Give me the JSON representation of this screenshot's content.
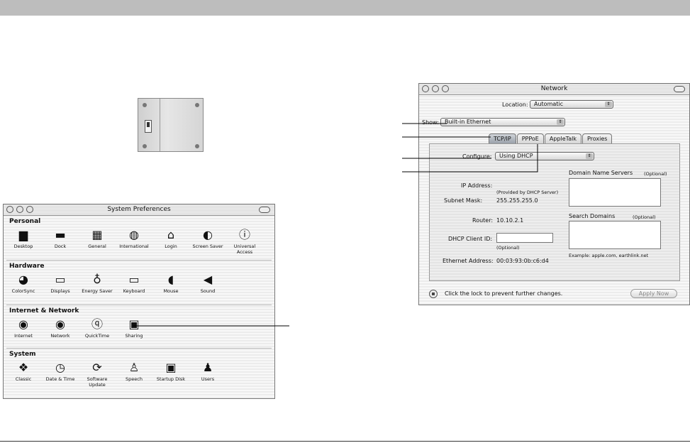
{
  "system_preferences": {
    "title": "System Preferences",
    "sections": [
      {
        "title": "Personal",
        "items": [
          {
            "label": "Desktop",
            "icon": "desktop-icon"
          },
          {
            "label": "Dock",
            "icon": "dock-icon"
          },
          {
            "label": "General",
            "icon": "general-icon"
          },
          {
            "label": "International",
            "icon": "international-icon"
          },
          {
            "label": "Login",
            "icon": "login-icon"
          },
          {
            "label": "Screen Saver",
            "icon": "screen-saver-icon"
          },
          {
            "label": "Universal Access",
            "icon": "universal-access-icon"
          }
        ]
      },
      {
        "title": "Hardware",
        "items": [
          {
            "label": "ColorSync",
            "icon": "colorsync-icon"
          },
          {
            "label": "Displays",
            "icon": "displays-icon"
          },
          {
            "label": "Energy Saver",
            "icon": "energy-saver-icon"
          },
          {
            "label": "Keyboard",
            "icon": "keyboard-icon"
          },
          {
            "label": "Mouse",
            "icon": "mouse-icon"
          },
          {
            "label": "Sound",
            "icon": "sound-icon"
          }
        ]
      },
      {
        "title": "Internet & Network",
        "items": [
          {
            "label": "Internet",
            "icon": "internet-icon"
          },
          {
            "label": "Network",
            "icon": "network-icon"
          },
          {
            "label": "QuickTime",
            "icon": "quicktime-icon"
          },
          {
            "label": "Sharing",
            "icon": "sharing-icon"
          }
        ]
      },
      {
        "title": "System",
        "items": [
          {
            "label": "Classic",
            "icon": "classic-icon"
          },
          {
            "label": "Date & Time",
            "icon": "date-time-icon"
          },
          {
            "label": "Software Update",
            "icon": "software-update-icon"
          },
          {
            "label": "Speech",
            "icon": "speech-icon"
          },
          {
            "label": "Startup Disk",
            "icon": "startup-disk-icon"
          },
          {
            "label": "Users",
            "icon": "users-icon"
          }
        ]
      }
    ]
  },
  "network": {
    "title": "Network",
    "location_label": "Location:",
    "location_value": "Automatic",
    "show_label": "Show:",
    "show_value": "Built-in Ethernet",
    "tabs": [
      "TCP/IP",
      "PPPoE",
      "AppleTalk",
      "Proxies"
    ],
    "active_tab": "TCP/IP",
    "configure_label": "Configure:",
    "configure_value": "Using DHCP",
    "ip_label": "IP Address:",
    "ip_note": "(Provided by DHCP Server)",
    "subnet_label": "Subnet Mask:",
    "subnet_value": "255.255.255.0",
    "router_label": "Router:",
    "router_value": "10.10.2.1",
    "dhcp_label": "DHCP Client ID:",
    "dhcp_value": "",
    "dhcp_note": "(Optional)",
    "ethernet_label": "Ethernet Address:",
    "ethernet_value": "00:03:93:0b:c6:d4",
    "dns_label": "Domain Name Servers",
    "dns_optional": "(Optional)",
    "search_label": "Search Domains",
    "search_optional": "(Optional)",
    "example_text": "Example: apple.com, earthlink.net",
    "lock_text": "Click the lock to prevent further changes.",
    "apply_button": "Apply Now"
  },
  "colors": {
    "topbar": "#bdbdbd",
    "active_tab": "#9aa1aa"
  }
}
